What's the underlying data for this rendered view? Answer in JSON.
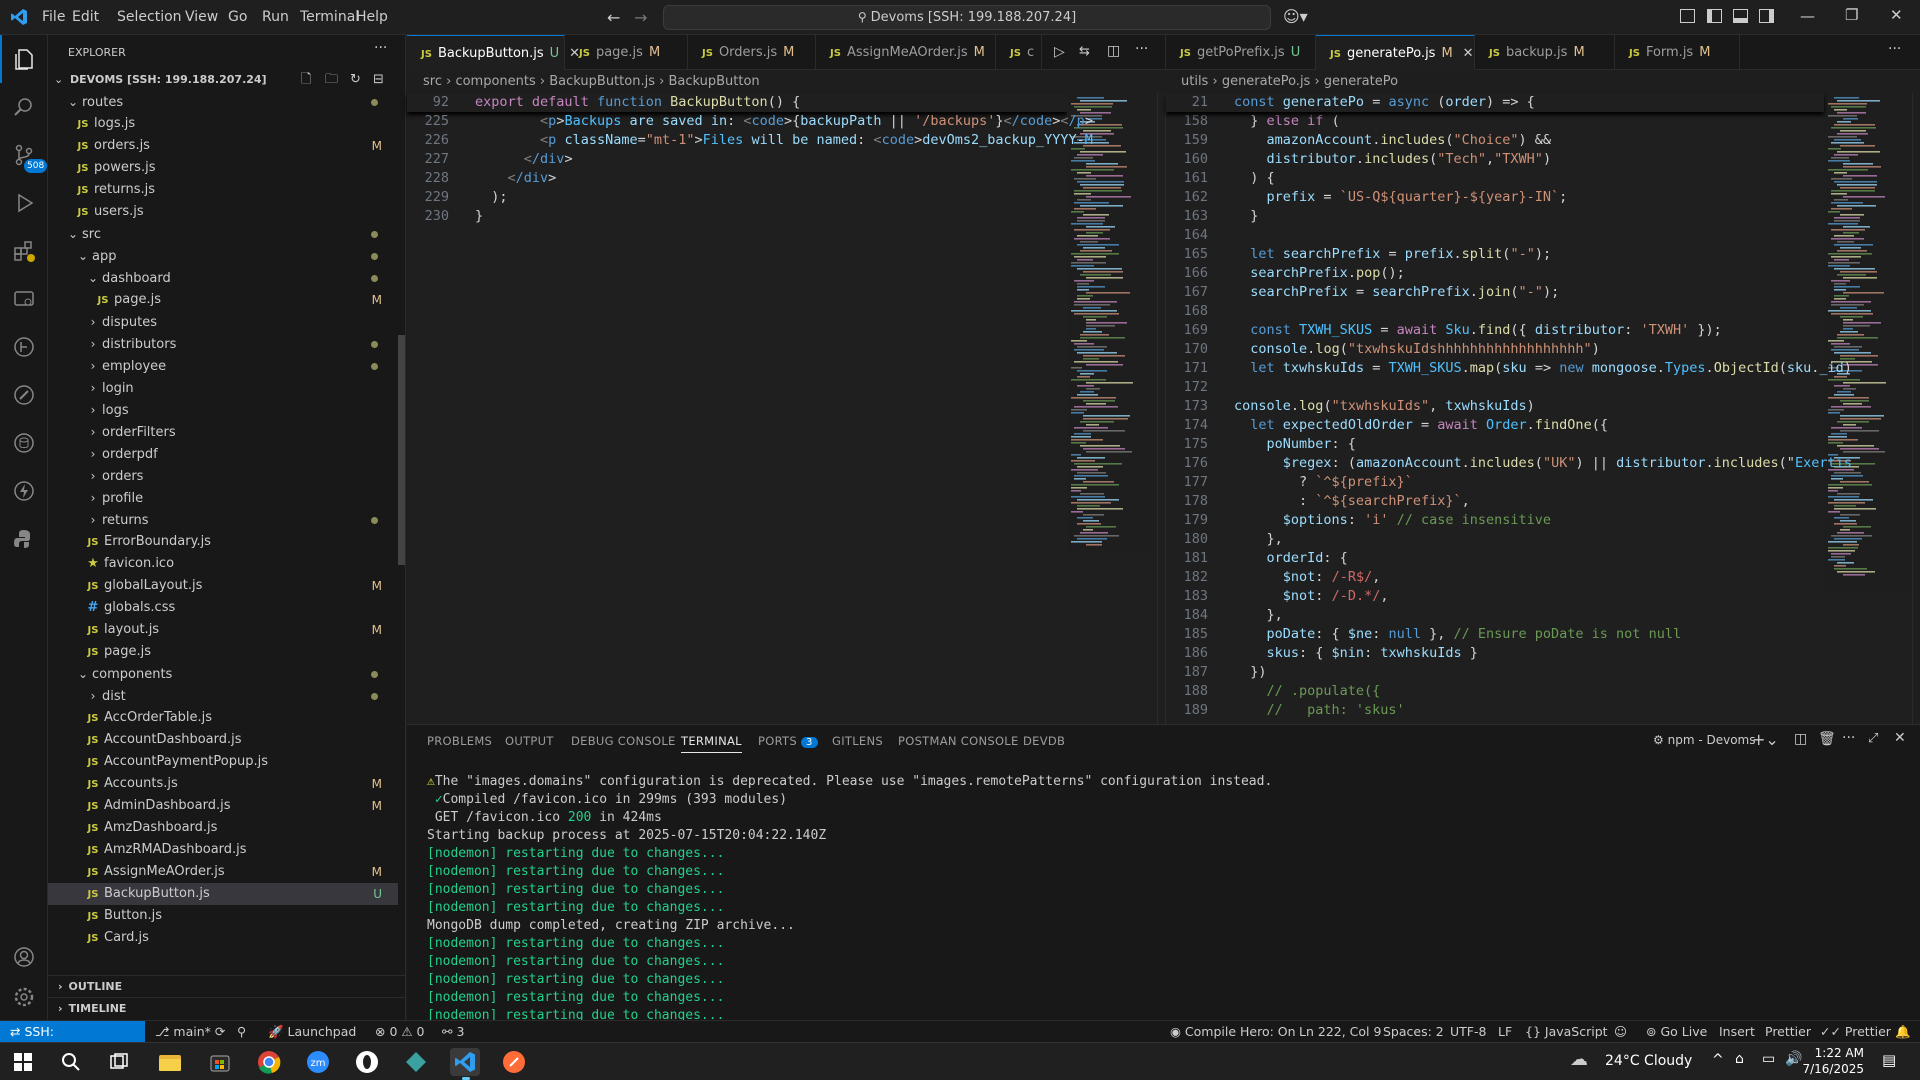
{
  "menu": [
    "File",
    "Edit",
    "Selection",
    "View",
    "Go",
    "Run",
    "Terminal",
    "Help"
  ],
  "command_center": "Devoms [SSH: 199.188.207.24]",
  "activity": {
    "scm_badge": "508"
  },
  "explorer": {
    "title": "EXPLORER",
    "root": "DEVOMS [SSH: 199.188.207.24]",
    "items": [
      {
        "label": "routes",
        "kind": "folder-open",
        "depth": 1,
        "dot": true
      },
      {
        "label": "logs.js",
        "kind": "js",
        "depth": 2,
        "status": ""
      },
      {
        "label": "orders.js",
        "kind": "js",
        "depth": 2,
        "status": "M"
      },
      {
        "label": "powers.js",
        "kind": "js",
        "depth": 2,
        "status": ""
      },
      {
        "label": "returns.js",
        "kind": "js",
        "depth": 2,
        "status": ""
      },
      {
        "label": "users.js",
        "kind": "js",
        "depth": 2,
        "status": ""
      },
      {
        "label": "src",
        "kind": "folder-open",
        "depth": 1,
        "dot": true
      },
      {
        "label": "app",
        "kind": "folder-open",
        "depth": 2,
        "dot": true
      },
      {
        "label": "dashboard",
        "kind": "folder-open",
        "depth": 3,
        "dot": true
      },
      {
        "label": "page.js",
        "kind": "js",
        "depth": 4,
        "status": "M"
      },
      {
        "label": "disputes",
        "kind": "folder",
        "depth": 3
      },
      {
        "label": "distributors",
        "kind": "folder",
        "depth": 3,
        "dot": true
      },
      {
        "label": "employee",
        "kind": "folder",
        "depth": 3,
        "dot": true
      },
      {
        "label": "login",
        "kind": "folder",
        "depth": 3
      },
      {
        "label": "logs",
        "kind": "folder",
        "depth": 3
      },
      {
        "label": "orderFilters",
        "kind": "folder",
        "depth": 3
      },
      {
        "label": "orderpdf",
        "kind": "folder",
        "depth": 3
      },
      {
        "label": "orders",
        "kind": "folder",
        "depth": 3
      },
      {
        "label": "profile",
        "kind": "folder",
        "depth": 3
      },
      {
        "label": "returns",
        "kind": "folder",
        "depth": 3,
        "dot": true
      },
      {
        "label": "ErrorBoundary.js",
        "kind": "js",
        "depth": 3,
        "status": ""
      },
      {
        "label": "favicon.ico",
        "kind": "star",
        "depth": 3,
        "status": ""
      },
      {
        "label": "globalLayout.js",
        "kind": "js",
        "depth": 3,
        "status": "M"
      },
      {
        "label": "globals.css",
        "kind": "css",
        "depth": 3,
        "status": ""
      },
      {
        "label": "layout.js",
        "kind": "js",
        "depth": 3,
        "status": "M"
      },
      {
        "label": "page.js",
        "kind": "js",
        "depth": 3,
        "status": ""
      },
      {
        "label": "components",
        "kind": "folder-open",
        "depth": 2,
        "dot": true
      },
      {
        "label": "dist",
        "kind": "folder",
        "depth": 3,
        "dot": true
      },
      {
        "label": "AccOrderTable.js",
        "kind": "js",
        "depth": 3,
        "status": ""
      },
      {
        "label": "AccountDashboard.js",
        "kind": "js",
        "depth": 3,
        "status": ""
      },
      {
        "label": "AccountPaymentPopup.js",
        "kind": "js",
        "depth": 3,
        "status": ""
      },
      {
        "label": "Accounts.js",
        "kind": "js",
        "depth": 3,
        "status": "M"
      },
      {
        "label": "AdminDashboard.js",
        "kind": "js",
        "depth": 3,
        "status": "M"
      },
      {
        "label": "AmzDashboard.js",
        "kind": "js",
        "depth": 3,
        "status": ""
      },
      {
        "label": "AmzRMADashboard.js",
        "kind": "js",
        "depth": 3,
        "status": ""
      },
      {
        "label": "AssignMeAOrder.js",
        "kind": "js",
        "depth": 3,
        "status": "M"
      },
      {
        "label": "BackupButton.js",
        "kind": "js",
        "depth": 3,
        "status": "U",
        "selected": true
      },
      {
        "label": "Button.js",
        "kind": "js",
        "depth": 3,
        "status": ""
      },
      {
        "label": "Card.js",
        "kind": "js",
        "depth": 3,
        "status": ""
      }
    ],
    "outline": "OUTLINE",
    "timeline": "TIMELINE"
  },
  "tabs_left": [
    {
      "label": "BackupButton.js",
      "status": "U",
      "active": true
    },
    {
      "label": "page.js",
      "status": "M"
    },
    {
      "label": "Orders.js",
      "status": "M"
    },
    {
      "label": "AssignMeAOrder.js",
      "status": "M"
    },
    {
      "label": "c",
      "status": ""
    }
  ],
  "tabs_right": [
    {
      "label": "getPoPrefix.js",
      "status": "U"
    },
    {
      "label": "generatePo.js",
      "status": "M",
      "active": true
    },
    {
      "label": "backup.js",
      "status": "M"
    },
    {
      "label": "Form.js",
      "status": "M"
    }
  ],
  "breadcrumb_left": [
    "src",
    "components",
    "BackupButton.js",
    "BackupButton"
  ],
  "breadcrumb_right": [
    "utils",
    "generatePo.js",
    "generatePo"
  ],
  "editor_left": {
    "sticky": {
      "num": "92",
      "text": "export default function BackupButton() {"
    },
    "lines": [
      {
        "num": "225",
        "text": "        <p>Backups are saved in: <code>{backupPath || '/backups'}</code></p>"
      },
      {
        "num": "226",
        "text": "        <p className=\"mt-1\">Files will be named: <code>devOms2_backup_YYYY-M"
      },
      {
        "num": "227",
        "text": "      </div>"
      },
      {
        "num": "228",
        "text": "    </div>"
      },
      {
        "num": "229",
        "text": "  );"
      },
      {
        "num": "230",
        "text": "}"
      }
    ]
  },
  "editor_right": {
    "sticky": {
      "num": "21",
      "text": "const generatePo = async (order) => {"
    },
    "lines": [
      {
        "num": "158",
        "text": "  } else if ("
      },
      {
        "num": "159",
        "text": "    amazonAccount.includes(\"Choice\") &&"
      },
      {
        "num": "160",
        "text": "    distributor.includes(\"Tech\",\"TXWH\")"
      },
      {
        "num": "161",
        "text": "  ) {"
      },
      {
        "num": "162",
        "text": "    prefix = `US-Q${quarter}-${year}-IN`;"
      },
      {
        "num": "163",
        "text": "  }"
      },
      {
        "num": "164",
        "text": ""
      },
      {
        "num": "165",
        "text": "  let searchPrefix = prefix.split(\"-\");"
      },
      {
        "num": "166",
        "text": "  searchPrefix.pop();"
      },
      {
        "num": "167",
        "text": "  searchPrefix = searchPrefix.join(\"-\");"
      },
      {
        "num": "168",
        "text": ""
      },
      {
        "num": "169",
        "text": "  const TXWH_SKUS = await Sku.find({ distributor: 'TXWH' });"
      },
      {
        "num": "170",
        "text": "  console.log(\"txwhskuIdshhhhhhhhhhhhhhhhhh\")"
      },
      {
        "num": "171",
        "text": "  let txwhskuIds = TXWH_SKUS.map(sku => new mongoose.Types.ObjectId(sku._id)"
      },
      {
        "num": "172",
        "text": ""
      },
      {
        "num": "173",
        "text": "console.log(\"txwhskuIds\", txwhskuIds)"
      },
      {
        "num": "174",
        "text": "  let expectedOldOrder = await Order.findOne({"
      },
      {
        "num": "175",
        "text": "    poNumber: {"
      },
      {
        "num": "176",
        "text": "      $regex: (amazonAccount.includes(\"UK\") || distributor.includes(\"Exertis"
      },
      {
        "num": "177",
        "text": "        ? `^${prefix}`"
      },
      {
        "num": "178",
        "text": "        : `^${searchPrefix}`,"
      },
      {
        "num": "179",
        "text": "      $options: 'i' // case insensitive"
      },
      {
        "num": "180",
        "text": "    },"
      },
      {
        "num": "181",
        "text": "    orderId: {"
      },
      {
        "num": "182",
        "text": "      $not: /-R$/,"
      },
      {
        "num": "183",
        "text": "      $not: /-D.*/,"
      },
      {
        "num": "184",
        "text": "    },"
      },
      {
        "num": "185",
        "text": "    poDate: { $ne: null }, // Ensure poDate is not null"
      },
      {
        "num": "186",
        "text": "    skus: { $nin: txwhskuIds }"
      },
      {
        "num": "187",
        "text": "  })"
      },
      {
        "num": "188",
        "text": "    // .populate({"
      },
      {
        "num": "189",
        "text": "    //   path: 'skus'"
      }
    ]
  },
  "panel": {
    "tabs": [
      "PROBLEMS",
      "OUTPUT",
      "DEBUG CONSOLE",
      "TERMINAL",
      "PORTS",
      "GITLENS",
      "POSTMAN CONSOLE",
      "DEVDB"
    ],
    "ports_badge": "3",
    "terminal_name": "npm - Devoms",
    "lines": [
      {
        "text": "⚠The \"images.domains\" configuration is deprecated. Please use \"images.remotePatterns\" configuration instead.",
        "kind": "plain"
      },
      {
        "text": " ✓Compiled /favicon.ico in 299ms (393 modules)",
        "kind": "plain"
      },
      {
        "text": " GET /favicon.ico 200 in 424ms",
        "kind": "plain"
      },
      {
        "text": "Starting backup process at 2025-07-15T20:04:22.140Z",
        "kind": "plain"
      },
      {
        "text": "[nodemon] restarting due to changes...",
        "kind": "green"
      },
      {
        "text": "[nodemon] restarting due to changes...",
        "kind": "green"
      },
      {
        "text": "[nodemon] restarting due to changes...",
        "kind": "green"
      },
      {
        "text": "[nodemon] restarting due to changes...",
        "kind": "green"
      },
      {
        "text": "MongoDB dump completed, creating ZIP archive...",
        "kind": "plain"
      },
      {
        "text": "[nodemon] restarting due to changes...",
        "kind": "green"
      },
      {
        "text": "[nodemon] restarting due to changes...",
        "kind": "green"
      },
      {
        "text": "[nodemon] restarting due to changes...",
        "kind": "green"
      },
      {
        "text": "[nodemon] restarting due to changes...",
        "kind": "green"
      },
      {
        "text": "[nodemon] restarting due to changes...",
        "kind": "green"
      }
    ]
  },
  "statusbar": {
    "remote": "SSH: 199.188.207.24",
    "branch": "main*",
    "launchpad": "Launchpad",
    "problems": "⊗ 0 ⚠ 0",
    "ports": "3",
    "compile_hero": "Compile Hero: On",
    "cursor": "Ln 222, Col 9",
    "spaces": "Spaces: 2",
    "encoding": "UTF-8",
    "eol": "LF",
    "language": "JavaScript",
    "golive": "Go Live",
    "insert": "Insert",
    "prettier1": "Prettier",
    "prettier2": "Prettier"
  },
  "taskbar": {
    "weather": "24°C  Cloudy",
    "time": "1:22 AM",
    "date": "7/16/2025"
  },
  "colors": {
    "accent": "#0078d4",
    "modified": "#e2c08d",
    "untracked": "#73c991",
    "js": "#cbcb41"
  }
}
